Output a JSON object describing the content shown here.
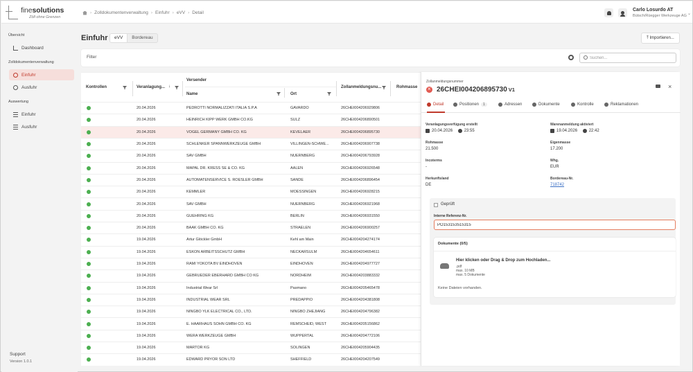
{
  "app": {
    "logo_name_light": "fine",
    "logo_name_bold": "solutions",
    "logo_tagline": "Zöll ohne Grenzen",
    "breadcrumbs": [
      "Zolldokumentenverwaltung",
      "Einfuhr",
      "eVV",
      "Detail"
    ],
    "user_name": "Carlo Losurdo AT",
    "user_company": "Bütsch/Rüegger Werkzeuge AG"
  },
  "sidebar": {
    "sections": [
      {
        "title": "Übersicht",
        "items": [
          {
            "label": "Dashboard",
            "icon": "chart-icon"
          }
        ]
      },
      {
        "title": "Zolldokumentenverwaltung",
        "items": [
          {
            "label": "Einfuhr",
            "icon": "import-icon",
            "active": true
          },
          {
            "label": "Ausfuhr",
            "icon": "export-icon"
          }
        ]
      },
      {
        "title": "Auswertung",
        "items": [
          {
            "label": "Einfuhr",
            "icon": "report-icon"
          },
          {
            "label": "Ausfuhr",
            "icon": "report-icon"
          }
        ]
      }
    ],
    "support": "Support",
    "version": "Version 1.0.1"
  },
  "page": {
    "title": "Einfuhr",
    "segments": [
      "eVV",
      "Bordereau"
    ],
    "import_label": "Importieren...",
    "filter_label": "Filter",
    "search_placeholder": "Suchen..."
  },
  "table": {
    "headers": {
      "kontrollen": "Kontrollen",
      "veranlagung": "Veranlagung...",
      "versender": "Versender",
      "name": "Name",
      "ort": "Ort",
      "zollanmeldung": "Zollanmeldungsnu...",
      "rohmasse": "Rohmasse"
    },
    "rows": [
      {
        "date": "20.04.2026",
        "name": "PEDROTTI NORMALIZZATI ITALIA S.P.A",
        "ort": "GAVARDO",
        "nr": "26CHEI004206929806"
      },
      {
        "date": "20.04.2026",
        "name": "HEINRICH KIPP WERK GMBH CO.KG",
        "ort": "SULZ",
        "nr": "26CHEI004206890501"
      },
      {
        "date": "20.04.2026",
        "name": "VOGEL GERMANY GMBH CO. KG",
        "ort": "KEVELAER",
        "nr": "26CHEI004206895730",
        "selected": true
      },
      {
        "date": "20.04.2026",
        "name": "SCHLENKER SPANNWERKZEUGE GMBH",
        "ort": "VILLINGEN-SCHWE...",
        "nr": "26CHEI004206907738"
      },
      {
        "date": "20.04.2026",
        "name": "SAV GMBH",
        "ort": "NUERNBERG",
        "nr": "26CHEI004206793928"
      },
      {
        "date": "20.04.2026",
        "name": "MAPAL DR. KRESS SE & CO. KG",
        "ort": "AALEN",
        "nr": "26CHEI004206926548"
      },
      {
        "date": "20.04.2026",
        "name": "AUTOMATENSERVICE S. ROESLER GMBH",
        "ort": "SANDE",
        "nr": "26CHEI004206896454"
      },
      {
        "date": "20.04.2026",
        "name": "KEMMLER",
        "ort": "MOESSINGEN",
        "nr": "26CHEI004206928215"
      },
      {
        "date": "20.04.2026",
        "name": "SAV GMBH",
        "ort": "NUERNBERG",
        "nr": "26CHEI004206921968"
      },
      {
        "date": "20.04.2026",
        "name": "GUEHRING KG",
        "ort": "BERLIN",
        "nr": "26CHEI004206931550"
      },
      {
        "date": "20.04.2026",
        "name": "BAAK GMBH CO. KG",
        "ort": "STRAELEN",
        "nr": "26CHEI004206900257"
      },
      {
        "date": "19.04.2026",
        "name": "Artur Glöckler GmbH",
        "ort": "Kehl am Main",
        "nr": "26CHEI004204274174"
      },
      {
        "date": "19.04.2026",
        "name": "ESKON ARBEITSSCHUTZ GMBH",
        "ort": "NECKARSULM",
        "nr": "26CHEI004204654611"
      },
      {
        "date": "19.04.2026",
        "name": "RAMI YOKOTA BV EINDHOVEN",
        "ort": "EINDHOVEN",
        "nr": "26CHEI004204977727"
      },
      {
        "date": "19.04.2026",
        "name": "GEBRUEDER EBERHARD GMBH CO KG",
        "ort": "NORDHEIM",
        "nr": "26CHEI004203883332"
      },
      {
        "date": "19.04.2026",
        "name": "Industrial Wear Srl",
        "ort": "Pasmano",
        "nr": "26CHEI004205465478"
      },
      {
        "date": "19.04.2026",
        "name": "INDUSTRIAL WEAR SRL",
        "ort": "PREDAPPIO",
        "nr": "26CHEI004204381808"
      },
      {
        "date": "19.04.2026",
        "name": "NINGBO YLK ELECTRICAL CO., LTD.",
        "ort": "NINGBO ZHEJIANG",
        "nr": "26CHEI004204796382"
      },
      {
        "date": "19.04.2026",
        "name": "E. HAARHAUS SOHN GMBH CO. KG",
        "ort": "REMSCHEID, WEST",
        "nr": "26CHEI004205156862"
      },
      {
        "date": "19.04.2026",
        "name": "WERA WERKZEUGE GMBH",
        "ort": "WUPPERTAL",
        "nr": "26CHEI004204772106"
      },
      {
        "date": "19.04.2026",
        "name": "MARTOR KG",
        "ort": "SOLINGEN",
        "nr": "26CHEI004205904435"
      },
      {
        "date": "19.04.2026",
        "name": "EDWARD PRYOR SON LTD",
        "ort": "SHEFFIELD",
        "nr": "26CHEI004204207549"
      }
    ]
  },
  "detail": {
    "small_label": "Zollanmeldungsnummer",
    "number": "26CHEI004206895730",
    "version": "V1",
    "tabs": [
      {
        "label": "Detail",
        "active": true
      },
      {
        "label": "Positionen",
        "badge": "1"
      },
      {
        "label": "Adressen"
      },
      {
        "label": "Dokumente"
      },
      {
        "label": "Kontrolle"
      },
      {
        "label": "Reklamationen"
      }
    ],
    "fields": {
      "verf_label": "Veranlagungsverfügung erstellt",
      "verf_date": "20.04.2026",
      "verf_time": "23:55",
      "waren_label": "Warenanmeldung aktiviert",
      "waren_date": "19.04.2026",
      "waren_time": "22:42",
      "roh_label": "Rohmasse",
      "roh_value": "21.500",
      "eigen_label": "Eigenmasse",
      "eigen_value": "17.200",
      "inco_label": "Incoterms",
      "inco_value": "-",
      "whg_label": "Whg.",
      "whg_value": "EUR",
      "herkunft_label": "Herkunftsland",
      "herkunft_value": "DE",
      "bord_label": "Bordereau-Nr.",
      "bord_value": "718742"
    },
    "geprueft_label": "Geprüft",
    "ref_label": "Interne Referenz-Nr.",
    "ref_value": "PO153153515315",
    "documents": {
      "title": "Dokumente (0/5)",
      "upload_title": "Hier klicken oder Drag & Drop zum Hochladen...",
      "upload_types": ".pdf",
      "upload_max_size": "max. 10 MB",
      "upload_max_docs": "max. 5 Dokumente",
      "empty": "Keine Dateien vorhanden."
    }
  },
  "colors": {
    "accent": "#c0392b",
    "ok": "#4caf50",
    "link": "#3a6fc4"
  }
}
